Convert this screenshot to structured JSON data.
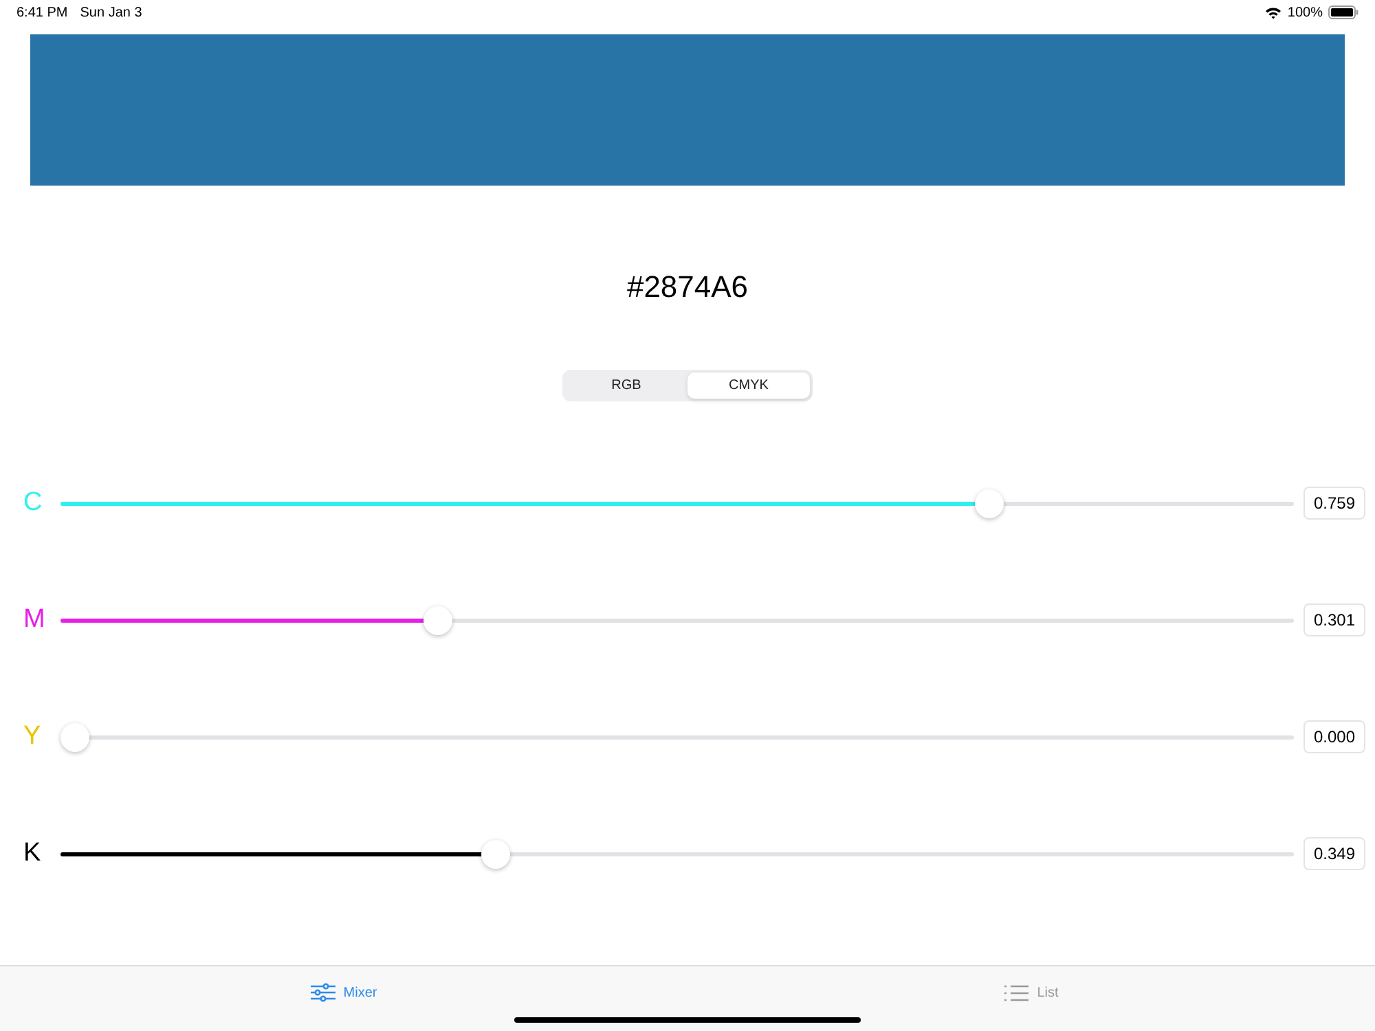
{
  "status_bar": {
    "time": "6:41 PM",
    "date": "Sun Jan 3",
    "battery": "100%"
  },
  "preview": {
    "color": "#2874a6"
  },
  "hex": "#2874A6",
  "segments": [
    {
      "label": "RGB",
      "selected": false
    },
    {
      "label": "CMYK",
      "selected": true
    }
  ],
  "channels": [
    {
      "name": "C",
      "color": "#2ef0f0",
      "level": 0.759,
      "reading": "0.759"
    },
    {
      "name": "M",
      "color": "#e620e6",
      "level": 0.301,
      "reading": "0.301"
    },
    {
      "name": "Y",
      "color": "#e8c400",
      "level": 0.0,
      "reading": "0.000"
    },
    {
      "name": "K",
      "color": "#000000",
      "level": 0.349,
      "reading": "0.349"
    }
  ],
  "tab_bar": [
    {
      "label": "Mixer",
      "kind": "sliders",
      "selected": true
    },
    {
      "label": "List",
      "kind": "list",
      "selected": false
    }
  ]
}
